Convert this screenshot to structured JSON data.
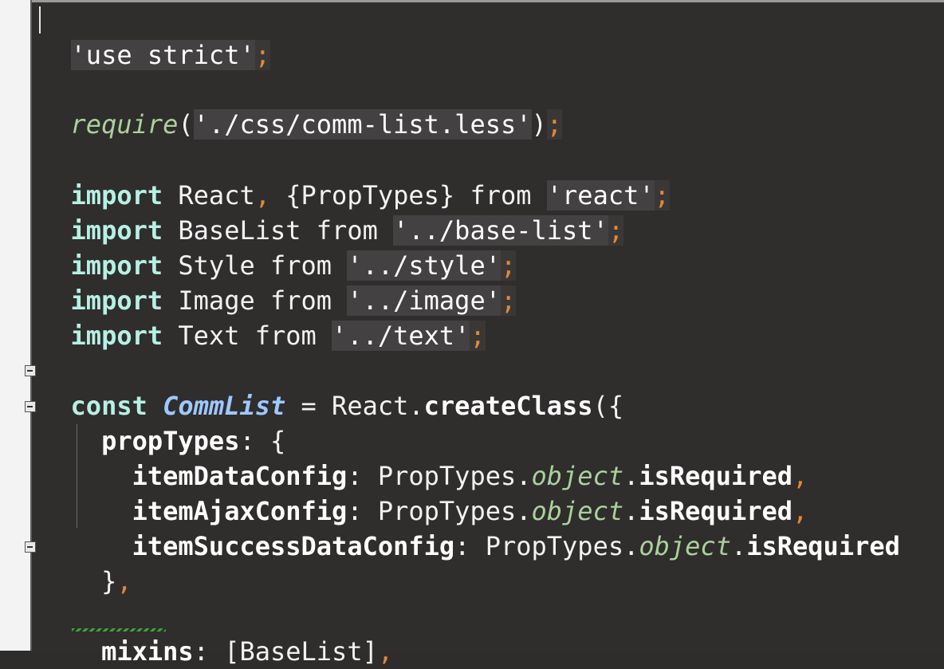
{
  "editor": {
    "theme_bg": "#302d2d",
    "gutter_bg": "#f3f3f3",
    "colors": {
      "keyword": "#b6f0e4",
      "string_bg": "#434141",
      "semicolon": "#e0893a",
      "italic_green": "#a9d29a",
      "class_name": "#9dc9ff"
    },
    "lines": {
      "l1_str": "'use strict'",
      "l1_semi": ";",
      "l3_fn": "require",
      "l3_open": "(",
      "l3_str": "'./css/comm-list.less'",
      "l3_close": ")",
      "l3_semi": ";",
      "l5_kw": "import",
      "l5_a": " React",
      "l5_comma": ",",
      "l5_b": " {PropTypes} ",
      "l5_from": "from",
      "l5_sp": " ",
      "l5_str": "'react'",
      "l5_semi": ";",
      "l6_kw": "import",
      "l6_a": " BaseList ",
      "l6_from": "from",
      "l6_sp": " ",
      "l6_str": "'../base-list'",
      "l6_semi": ";",
      "l7_kw": "import",
      "l7_a": " Style ",
      "l7_from": "from",
      "l7_sp": " ",
      "l7_str": "'../style'",
      "l7_semi": ";",
      "l8_kw": "import",
      "l8_a": " Image ",
      "l8_from": "from",
      "l8_sp": " ",
      "l8_str": "'../image'",
      "l8_semi": ";",
      "l9_kw": "import",
      "l9_a": " Text ",
      "l9_from": "from",
      "l9_sp": " ",
      "l9_str": "'../text'",
      "l9_semi": ";",
      "l11_kw": "const",
      "l11_sp": " ",
      "l11_cls": "CommList",
      "l11_a": " = React.",
      "l11_method": "createClass",
      "l11_b": "({",
      "l12_indent": "  ",
      "l12_key": "propTypes",
      "l12_rest": ": {",
      "l13_indent": "    ",
      "l13_key": "itemDataConfig",
      "l13_a": ": PropTypes.",
      "l13_obj": "object",
      "l13_dot": ".",
      "l13_req": "isRequired",
      "l13_comma": ",",
      "l14_indent": "    ",
      "l14_key": "itemAjaxConfig",
      "l14_a": ": PropTypes.",
      "l14_obj": "object",
      "l14_dot": ".",
      "l14_req": "isRequired",
      "l14_comma": ",",
      "l15_indent": "    ",
      "l15_key": "itemSuccessDataConfig",
      "l15_a": ": PropTypes.",
      "l15_obj": "object",
      "l15_dot": ".",
      "l15_req": "isRequired",
      "l16_indent": "  ",
      "l16_a": "}",
      "l16_comma": ",",
      "l18_indent": "  ",
      "l18_key": "mixins",
      "l18_a": ": [BaseList]",
      "l18_comma": ","
    }
  }
}
